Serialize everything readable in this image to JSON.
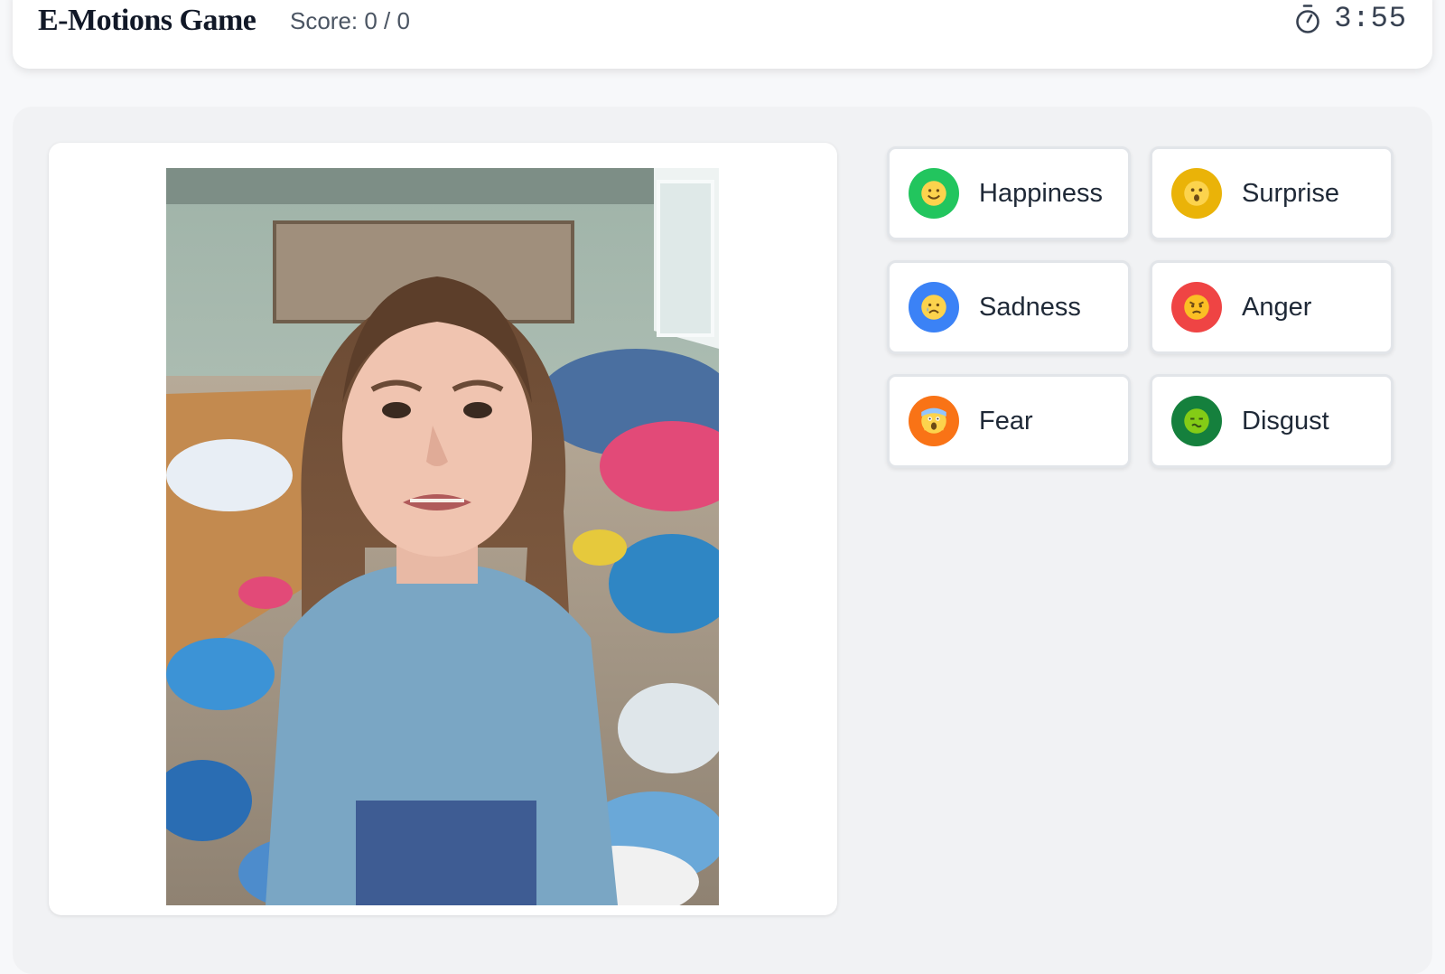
{
  "header": {
    "title": "E-Motions Game",
    "score": "Score: 0 / 0",
    "timer": "3:55",
    "timer_icon": "stopwatch-icon"
  },
  "main": {
    "image": {
      "subject": "photo-of-girl"
    },
    "options": [
      {
        "label": "Happiness",
        "icon": "smiling-face-icon",
        "color": "#22c55e"
      },
      {
        "label": "Surprise",
        "icon": "surprised-face-icon",
        "color": "#eab308"
      },
      {
        "label": "Sadness",
        "icon": "crying-face-icon",
        "color": "#3b82f6"
      },
      {
        "label": "Anger",
        "icon": "angry-face-icon",
        "color": "#ef4444"
      },
      {
        "label": "Fear",
        "icon": "screaming-face-icon",
        "color": "#f97316"
      },
      {
        "label": "Disgust",
        "icon": "nauseated-face-icon",
        "color": "#15803d"
      }
    ]
  }
}
